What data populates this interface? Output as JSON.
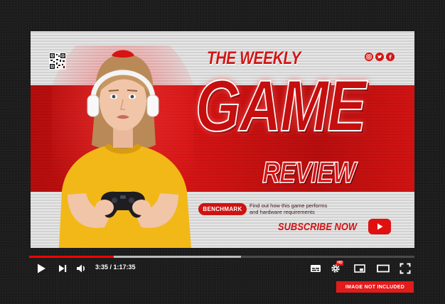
{
  "thumbnail": {
    "title_line1": "THE WEEKLY",
    "title_line2": "GAME",
    "title_line3": "REVIEW",
    "badge_label": "BENCHMARK",
    "tagline": "Find out how this game performs and hardware requirements",
    "subscribe_label": "SUBSCRIBE NOW",
    "social_icons": [
      "instagram-icon",
      "twitter-icon",
      "facebook-icon"
    ],
    "colors": {
      "accent": "#d21414",
      "band": "#c40e0e",
      "background": "#e2e2e2"
    }
  },
  "player": {
    "time": "3:35 / 1:17:35",
    "progress_played": 0.22,
    "progress_buffered": 0.55,
    "quality_badge": "HD",
    "colors": {
      "progress": "#ff0000",
      "buffer": "#bcbcbc",
      "track": "#4a4a4a"
    }
  },
  "notice": "IMAGE NOT INCLUDED"
}
